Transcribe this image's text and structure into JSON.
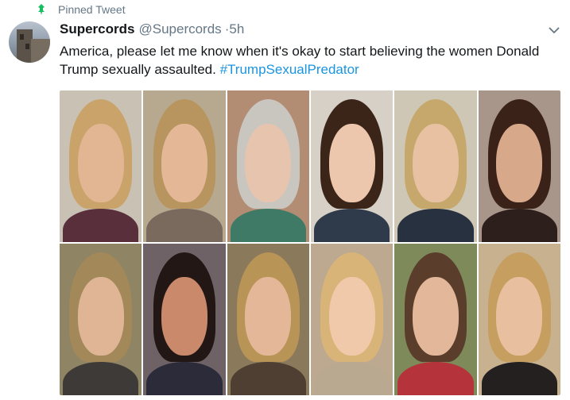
{
  "pinned": {
    "label": "Pinned Tweet",
    "icon": "pin-icon",
    "icon_color": "#17bf63"
  },
  "tweet": {
    "display_name": "Supercords",
    "handle": "@Supercords",
    "separator": "·",
    "time": "5h",
    "text_plain": "America, please let me know when it's okay to start believing the women Donald Trump sexually assaulted.",
    "hashtag": "#TrumpSexualPredator",
    "hashtag_color": "#1b95e0",
    "caret_icon": "chevron-down-icon"
  },
  "media": {
    "photo_count": 12,
    "photos": [
      {
        "bg": "#c9c2b4",
        "hair": "#c9a36a",
        "face": "#e2b593",
        "top": "#5a2f3c"
      },
      {
        "bg": "#b7a98f",
        "hair": "#b8945f",
        "face": "#e4b796",
        "top": "#7a6a5e"
      },
      {
        "bg": "#b38c74",
        "hair": "#c9c6c0",
        "face": "#e6c4ae",
        "top": "#3e7a66"
      },
      {
        "bg": "#d7d0c7",
        "hair": "#3b2418",
        "face": "#ecc6ad",
        "top": "#2f3b4a"
      },
      {
        "bg": "#cfc7b6",
        "hair": "#c7a86c",
        "face": "#e8c1a3",
        "top": "#27313f"
      },
      {
        "bg": "#a9968a",
        "hair": "#3b2219",
        "face": "#d8a88a",
        "top": "#2d1f1c"
      },
      {
        "bg": "#8f8464",
        "hair": "#a38959",
        "face": "#e0b596",
        "top": "#3d3a37"
      },
      {
        "bg": "#6f6266",
        "hair": "#221715",
        "face": "#c9896a",
        "top": "#2b2b3a"
      },
      {
        "bg": "#8a7a5b",
        "hair": "#b99457",
        "face": "#e3b797",
        "top": "#4f3f33"
      },
      {
        "bg": "#bda98f",
        "hair": "#d9b479",
        "face": "#f0c8aa",
        "top": "#b9a990"
      },
      {
        "bg": "#7e8a5a",
        "hair": "#5a3d2a",
        "face": "#e3b79a",
        "top": "#b5333b"
      },
      {
        "bg": "#c7b18f",
        "hair": "#c69e5f",
        "face": "#e8c0a0",
        "top": "#23201f"
      }
    ]
  }
}
